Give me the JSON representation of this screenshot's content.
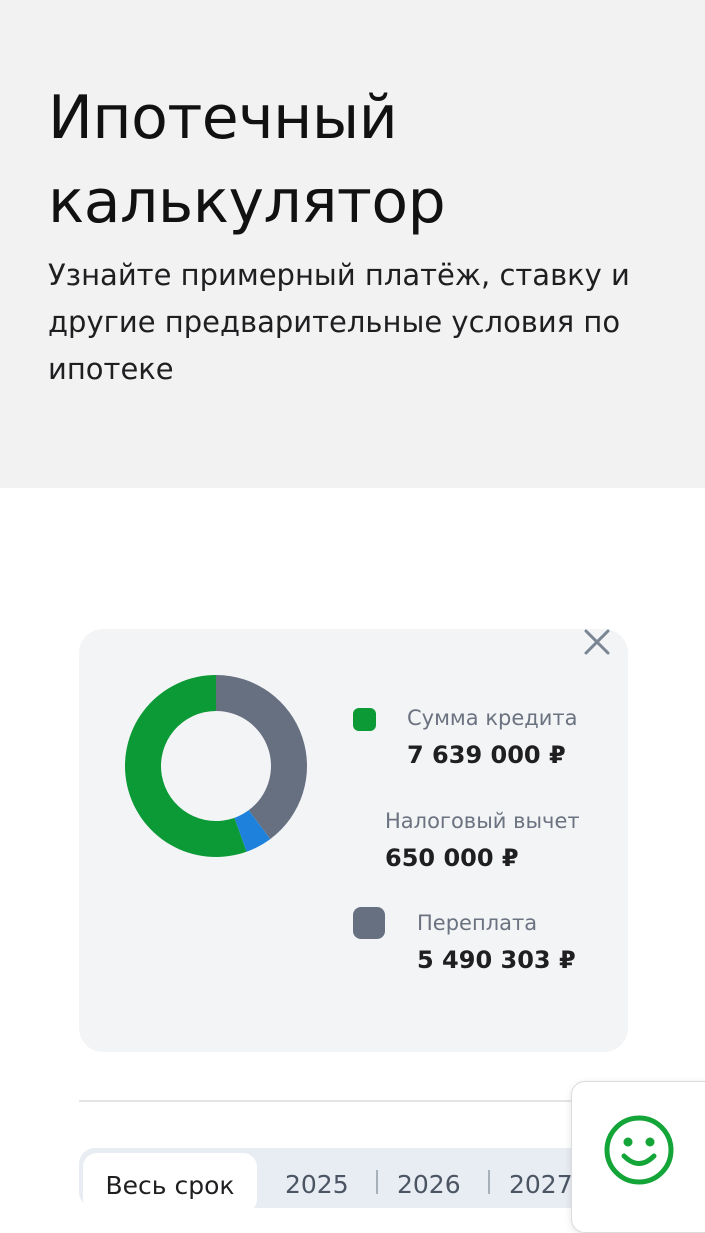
{
  "hero": {
    "title": "Ипотечный калькулятор",
    "subtitle": "Узнайте примерный платёж, ставку и другие предварительные условия по ипотеке"
  },
  "chart_data": {
    "type": "pie",
    "series": [
      {
        "name": "Сумма кредита",
        "value": 7639000,
        "color": "#0b9a35"
      },
      {
        "name": "Налоговый вычет",
        "value": 650000,
        "color": "#1e82dc"
      },
      {
        "name": "Переплата",
        "value": 5490303,
        "color": "#667080"
      }
    ]
  },
  "legend": {
    "loan_label": "Сумма кредита",
    "loan_value": "7 639 000 ₽",
    "deduction_label": "Налоговый вычет",
    "deduction_value": "650 000 ₽",
    "overpayment_label": "Переплата",
    "overpayment_value": "5 490 303 ₽"
  },
  "icons": {
    "close": "close-icon",
    "assistant": "smiley-icon"
  },
  "colors": {
    "accent_green": "#0b9a35",
    "blue": "#1e82dc",
    "gray": "#667080"
  },
  "tabs": [
    {
      "label": "Весь срок",
      "active": true
    },
    {
      "label": "2025",
      "active": false
    },
    {
      "label": "2026",
      "active": false
    },
    {
      "label": "2027",
      "active": false
    }
  ]
}
